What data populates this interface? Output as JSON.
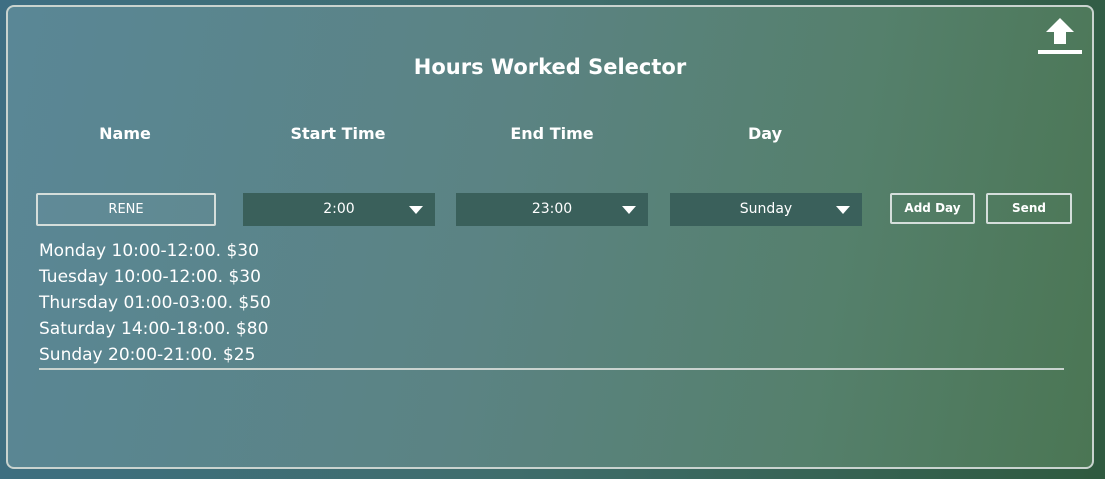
{
  "title": "Hours Worked Selector",
  "columns": {
    "name": "Name",
    "start": "Start Time",
    "end": "End Time",
    "day": "Day"
  },
  "form": {
    "name_value": "RENE",
    "start_value": "2:00",
    "end_value": "23:00",
    "day_value": "Sunday",
    "add_day_label": "Add Day",
    "send_label": "Send"
  },
  "entries": [
    "Monday 10:00-12:00. $30",
    "Tuesday 10:00-12:00. $30",
    "Thursday 01:00-03:00. $50",
    "Saturday 14:00-18:00. $80",
    "Sunday 20:00-21:00. $25"
  ],
  "icons": {
    "upload": "upload-icon"
  }
}
